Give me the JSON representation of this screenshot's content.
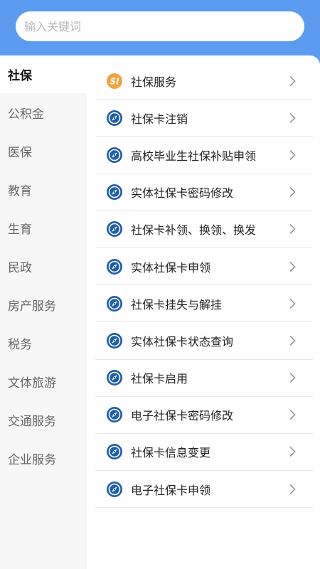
{
  "search": {
    "placeholder": "输入关键词"
  },
  "sidebar": {
    "items": [
      {
        "label": "社保",
        "active": true
      },
      {
        "label": "公积金"
      },
      {
        "label": "医保"
      },
      {
        "label": "教育"
      },
      {
        "label": "生育"
      },
      {
        "label": "民政"
      },
      {
        "label": "房产服务"
      },
      {
        "label": "税务"
      },
      {
        "label": "文体旅游"
      },
      {
        "label": "交通服务"
      },
      {
        "label": "企业服务"
      }
    ]
  },
  "services": [
    {
      "label": "社保服务",
      "icon": "si-badge-icon"
    },
    {
      "label": "社保卡注销",
      "icon": "compass-icon"
    },
    {
      "label": "高校毕业生社保补贴申领",
      "icon": "compass-icon"
    },
    {
      "label": "实体社保卡密码修改",
      "icon": "compass-icon"
    },
    {
      "label": "社保卡补领、换领、换发",
      "icon": "compass-icon"
    },
    {
      "label": "实体社保卡申领",
      "icon": "compass-icon"
    },
    {
      "label": "社保卡挂失与解挂",
      "icon": "compass-icon"
    },
    {
      "label": "实体社保卡状态查询",
      "icon": "compass-icon"
    },
    {
      "label": "社保卡启用",
      "icon": "compass-icon"
    },
    {
      "label": "电子社保卡密码修改",
      "icon": "compass-icon"
    },
    {
      "label": "社保卡信息变更",
      "icon": "compass-icon"
    },
    {
      "label": "电子社保卡申领",
      "icon": "compass-icon"
    }
  ],
  "colors": {
    "header": "#5c9cf0",
    "compass": "#1f5fa8",
    "si_badge": "#f5a23a"
  }
}
